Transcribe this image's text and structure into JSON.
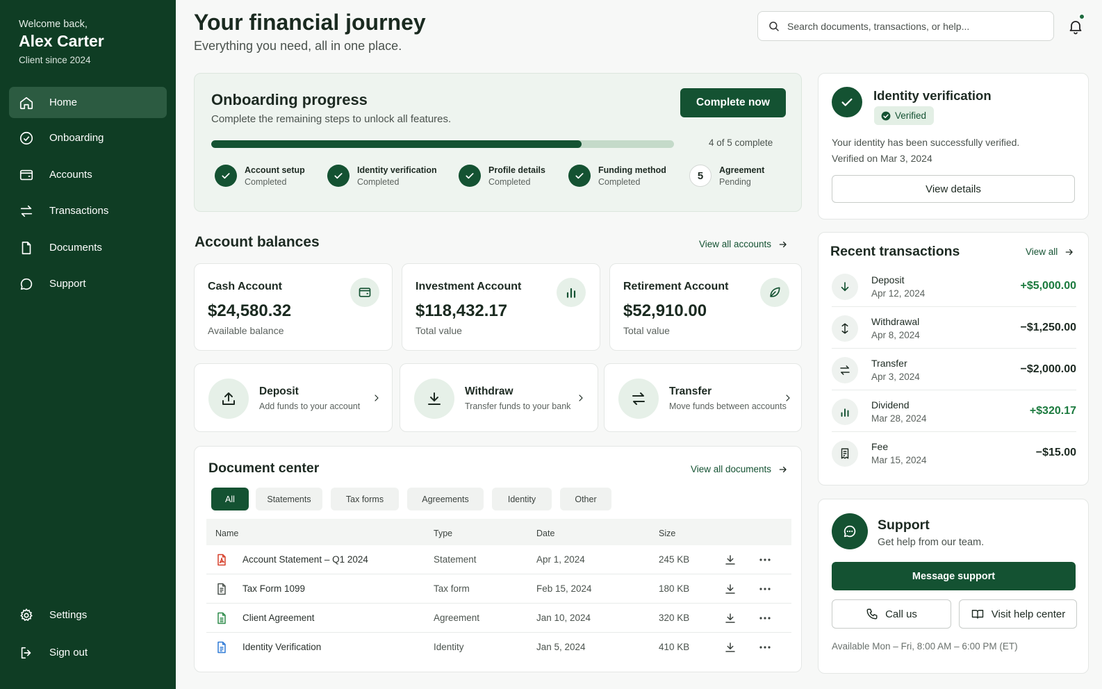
{
  "sidebar": {
    "welcome": "Welcome back,",
    "user_name": "Alex Carter",
    "client_since": "Client since 2024",
    "nav": [
      {
        "label": "Home",
        "icon": "home-icon",
        "active": true
      },
      {
        "label": "Onboarding",
        "icon": "check-circle-icon"
      },
      {
        "label": "Accounts",
        "icon": "wallet-icon"
      },
      {
        "label": "Transactions",
        "icon": "transfer-arrows-icon"
      },
      {
        "label": "Documents",
        "icon": "document-icon"
      },
      {
        "label": "Support",
        "icon": "chat-bubble-icon"
      }
    ],
    "bottom": [
      {
        "label": "Settings",
        "icon": "gear-icon"
      },
      {
        "label": "Sign out",
        "icon": "sign-out-icon"
      }
    ]
  },
  "header": {
    "title": "Your financial journey",
    "subtitle": "Everything you need, all in one place.",
    "search_placeholder": "Search documents, transactions, or help..."
  },
  "onboarding": {
    "title": "Onboarding progress",
    "subtitle": "Complete the remaining steps to unlock all features.",
    "button": "Complete now",
    "progress_fraction": 0.8,
    "progress_text": "4 of 5 complete",
    "steps": [
      {
        "name": "Account setup",
        "status": "Completed"
      },
      {
        "name": "Identity verification",
        "status": "Completed"
      },
      {
        "name": "Profile details",
        "status": "Completed"
      },
      {
        "name": "Funding method",
        "status": "Completed"
      },
      {
        "name": "Agreement",
        "status": "Pending",
        "number": "5"
      }
    ]
  },
  "balances": {
    "title": "Account balances",
    "link": "View all accounts",
    "accounts": [
      {
        "name": "Cash Account",
        "value": "$24,580.32",
        "label": "Available balance",
        "icon": "wallet-icon"
      },
      {
        "name": "Investment Account",
        "value": "$118,432.17",
        "label": "Total value",
        "icon": "bar-chart-icon"
      },
      {
        "name": "Retirement Account",
        "value": "$52,910.00",
        "label": "Total value",
        "icon": "leaf-icon"
      }
    ]
  },
  "actions": [
    {
      "title": "Deposit",
      "subtitle": "Add funds to your account",
      "icon": "upload-icon"
    },
    {
      "title": "Withdraw",
      "subtitle": "Transfer funds to your bank",
      "icon": "download-icon"
    },
    {
      "title": "Transfer",
      "subtitle": "Move funds between accounts",
      "icon": "transfer-arrows-icon"
    }
  ],
  "documents": {
    "title": "Document center",
    "link": "View all documents",
    "tabs": [
      "All",
      "Statements",
      "Tax forms",
      "Agreements",
      "Identity",
      "Other"
    ],
    "columns": [
      "Name",
      "Type",
      "Date",
      "Size"
    ],
    "rows": [
      {
        "name": "Account Statement – Q1 2024",
        "type": "Statement",
        "date": "Apr 1, 2024",
        "size": "245 KB",
        "icon": "pdf-icon"
      },
      {
        "name": "Tax Form 1099",
        "type": "Tax form",
        "date": "Feb 15, 2024",
        "size": "180 KB",
        "icon": "file-text-icon"
      },
      {
        "name": "Client Agreement",
        "type": "Agreement",
        "date": "Jan 10, 2024",
        "size": "320 KB",
        "icon": "file-agreement-icon"
      },
      {
        "name": "Identity Verification",
        "type": "Identity",
        "date": "Jan 5, 2024",
        "size": "410 KB",
        "icon": "file-identity-icon"
      }
    ]
  },
  "identity": {
    "title": "Identity verification",
    "badge": "Verified",
    "line1": "Your identity has been successfully verified.",
    "line2": "Verified on Mar 3, 2024",
    "button": "View details"
  },
  "transactions": {
    "title": "Recent transactions",
    "link": "View all",
    "items": [
      {
        "name": "Deposit",
        "date": "Apr 12, 2024",
        "amount": "+$5,000.00",
        "positive": true,
        "icon": "arrow-down-icon"
      },
      {
        "name": "Withdrawal",
        "date": "Apr 8, 2024",
        "amount": "−$1,250.00",
        "positive": false,
        "icon": "arrows-up-down-icon"
      },
      {
        "name": "Transfer",
        "date": "Apr 3, 2024",
        "amount": "−$2,000.00",
        "positive": false,
        "icon": "transfer-arrows-icon"
      },
      {
        "name": "Dividend",
        "date": "Mar 28, 2024",
        "amount": "+$320.17",
        "positive": true,
        "icon": "bar-chart-icon"
      },
      {
        "name": "Fee",
        "date": "Mar 15, 2024",
        "amount": "−$15.00",
        "positive": false,
        "icon": "receipt-icon"
      }
    ]
  },
  "support": {
    "title": "Support",
    "subtitle": "Get help from our team.",
    "message_button": "Message support",
    "call_button": "Call us",
    "help_button": "Visit help center",
    "hours": "Available Mon – Fri, 8:00 AM – 6:00 PM (ET)"
  },
  "colors": {
    "sidebar_bg": "#0f3d24",
    "accent": "#145232",
    "positive": "#1b7a3e",
    "pdf_red": "#d6402b",
    "agreement_green": "#2e8b4a",
    "identity_blue": "#2f7ad6"
  }
}
